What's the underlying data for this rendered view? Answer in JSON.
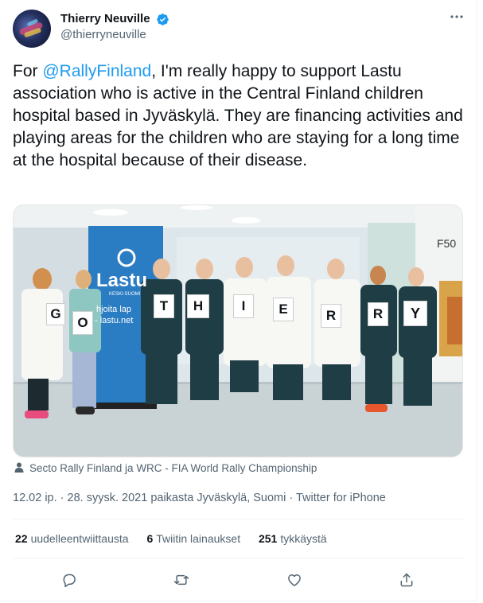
{
  "author": {
    "display_name": "Thierry Neuville",
    "handle": "@thierryneuville",
    "verified": true
  },
  "tweet": {
    "mention": "@RallyFinland",
    "text_before": "For ",
    "text_after": ", I'm really happy to support Lastu association who is active in the Central Finland children hospital based in Jyväskylä. They are financing activities and playing areas for the children who are staying for a long time at the hospital because of their disease."
  },
  "photo": {
    "banner_brand": "Lastu",
    "banner_sub": "KESKI-SUOMI",
    "banner_line1": "hjoita lap",
    "banner_line2": "- lastu.net",
    "room_sign": "F50",
    "cards": [
      "G",
      "O",
      "T",
      "H",
      "I",
      "E",
      "R",
      "R",
      "Y"
    ]
  },
  "tagged": "Secto Rally Finland ja WRC - FIA World Rally Championship",
  "meta": {
    "time": "12.02 ip.",
    "date": "28. syysk. 2021",
    "location": "paikasta Jyväskylä, Suomi",
    "source": "Twitter for iPhone"
  },
  "stats": {
    "retweets": "22",
    "retweets_label": "uudelleentwiittausta",
    "quotes": "6",
    "quotes_label": "Twiitin lainaukset",
    "likes": "251",
    "likes_label": "tykkäystä"
  },
  "colors": {
    "accent": "#1d9bf0",
    "text": "#0f1419",
    "secondary": "#536471",
    "banner_blue": "#2a7cc3"
  },
  "icons": [
    "more-icon",
    "verified-badge-icon",
    "person-icon",
    "reply-icon",
    "retweet-icon",
    "like-icon",
    "share-icon"
  ]
}
